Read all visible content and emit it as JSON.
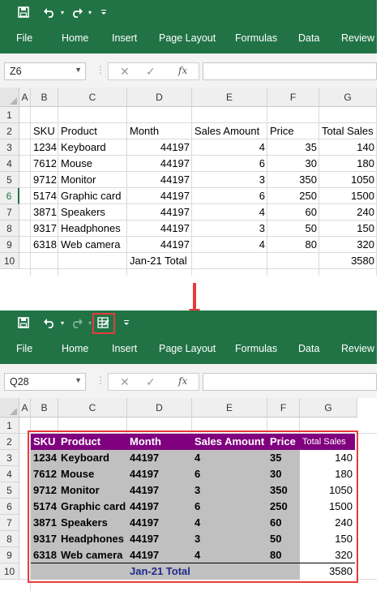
{
  "ribbon": {
    "tabs": [
      "File",
      "Home",
      "Insert",
      "Page Layout",
      "Formulas",
      "Data",
      "Review"
    ]
  },
  "top": {
    "name_box": "Z6",
    "fx_label": "fx",
    "columns": [
      "A",
      "B",
      "C",
      "D",
      "E",
      "F",
      "G"
    ],
    "rows": [
      "1",
      "2",
      "3",
      "4",
      "5",
      "6",
      "7",
      "8",
      "9",
      "10"
    ],
    "selected_row": "6",
    "headers": [
      "SKU",
      "Product",
      "Month",
      "Sales Amount",
      "Price",
      "Total Sales"
    ],
    "data_rows": [
      [
        "1234",
        "Keyboard",
        "44197",
        "4",
        "35",
        "140"
      ],
      [
        "7612",
        "Mouse",
        "44197",
        "6",
        "30",
        "180"
      ],
      [
        "9712",
        "Monitor",
        "44197",
        "3",
        "350",
        "1050"
      ],
      [
        "5174",
        "Graphic card",
        "44197",
        "6",
        "250",
        "1500"
      ],
      [
        "3871",
        "Speakers",
        "44197",
        "4",
        "60",
        "240"
      ],
      [
        "9317",
        "Headphones",
        "44197",
        "3",
        "50",
        "150"
      ],
      [
        "6318",
        "Web camera",
        "44197",
        "4",
        "80",
        "320"
      ]
    ],
    "total_row": {
      "label": "Jan-21 Total",
      "value": "3580"
    }
  },
  "bottom": {
    "name_box": "Q28",
    "fx_label": "fx",
    "columns": [
      "A",
      "B",
      "C",
      "D",
      "E",
      "F",
      "G"
    ],
    "rows": [
      "1",
      "2",
      "3",
      "4",
      "5",
      "6",
      "7",
      "8",
      "9",
      "10"
    ],
    "headers": [
      "SKU",
      "Product",
      "Month",
      "Sales Amount",
      "Price",
      "Total Sales"
    ],
    "data_rows": [
      [
        "1234",
        "Keyboard",
        "44197",
        "4",
        "35",
        "140"
      ],
      [
        "7612",
        "Mouse",
        "44197",
        "6",
        "30",
        "180"
      ],
      [
        "9712",
        "Monitor",
        "44197",
        "3",
        "350",
        "1050"
      ],
      [
        "5174",
        "Graphic card",
        "44197",
        "6",
        "250",
        "1500"
      ],
      [
        "3871",
        "Speakers",
        "44197",
        "4",
        "60",
        "240"
      ],
      [
        "9317",
        "Headphones",
        "44197",
        "3",
        "50",
        "150"
      ],
      [
        "6318",
        "Web camera",
        "44197",
        "4",
        "80",
        "320"
      ]
    ],
    "total_row": {
      "label": "Jan-21 Total",
      "value": "3580"
    }
  },
  "colors": {
    "ribbon_green": "#217346",
    "header_purple": "#800080",
    "body_gray": "#c0c0c0",
    "highlight_red": "#e53b3b",
    "total_label_blue": "#1f2a8c"
  },
  "icons": {
    "save": "save-icon",
    "undo": "undo-icon",
    "redo": "redo-icon",
    "customize": "customize-qat-icon",
    "autoformat": "autoformat-icon",
    "cancel": "cancel-icon",
    "enter": "check-icon",
    "function": "insert-function-icon"
  }
}
